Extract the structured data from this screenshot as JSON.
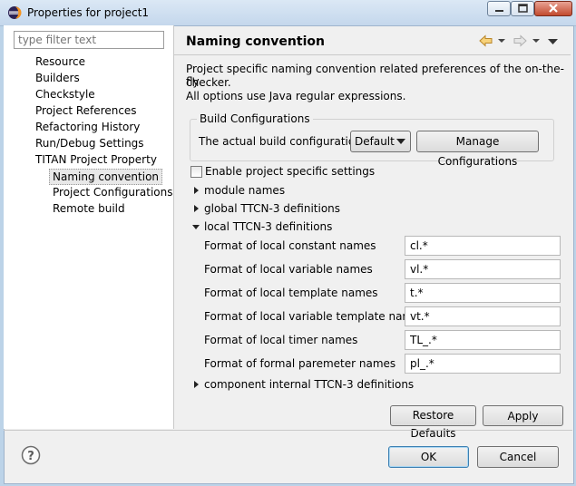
{
  "window": {
    "title": "Properties for project1"
  },
  "filter": {
    "placeholder": "type filter text"
  },
  "tree": {
    "items": [
      "Resource",
      "Builders",
      "Checkstyle",
      "Project References",
      "Refactoring History",
      "Run/Debug Settings",
      "TITAN Project Property",
      "Naming convention",
      "Project Configurations",
      "Remote build"
    ],
    "selected": "Naming convention"
  },
  "page": {
    "title": "Naming convention",
    "description_line1": "Project specific naming convention related preferences of the on-the-fly",
    "description_line2": "checker.",
    "description_line3": "All options use Java regular expressions."
  },
  "build_config": {
    "group_title": "Build Configurations",
    "label": "The actual build configuration:",
    "selected": "Default",
    "manage_label": "Manage Configurations"
  },
  "enable_label": "Enable project specific settings",
  "sections": {
    "module": "module names",
    "global": "global TTCN-3 definitions",
    "local": "local TTCN-3 definitions",
    "component": "component internal TTCN-3 definitions"
  },
  "fields": [
    {
      "label": "Format of local constant names",
      "value": "cl.*"
    },
    {
      "label": "Format of local variable names",
      "value": "vl.*"
    },
    {
      "label": "Format of local template names",
      "value": "t.*"
    },
    {
      "label": "Format of local variable template names",
      "value": "vt.*"
    },
    {
      "label": "Format of local timer names",
      "value": "TL_.*"
    },
    {
      "label": "Format of formal paremeter names",
      "value": "pl_.*"
    }
  ],
  "buttons": {
    "restore": "Restore Defaults",
    "apply": "Apply",
    "ok": "OK",
    "cancel": "Cancel"
  },
  "icons": {
    "app": "eclipse-icon",
    "help": "help-icon",
    "back": "back-arrow-icon",
    "forward": "forward-arrow-icon"
  }
}
